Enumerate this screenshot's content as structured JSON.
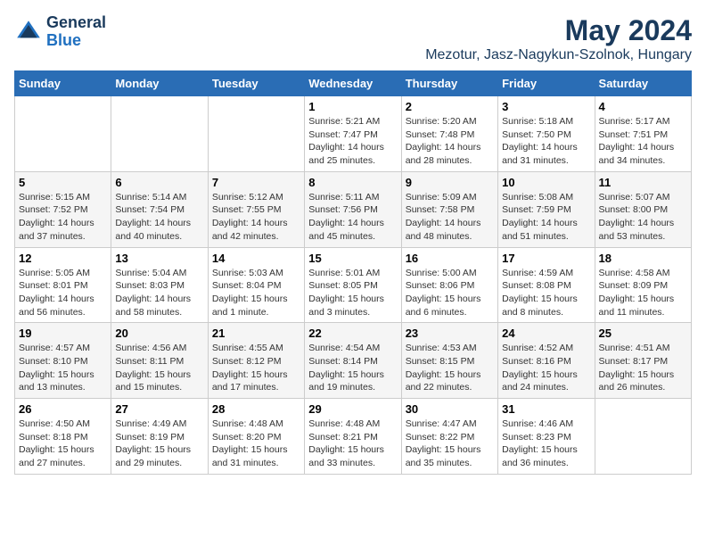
{
  "header": {
    "logo_general": "General",
    "logo_blue": "Blue",
    "main_title": "May 2024",
    "subtitle": "Mezotur, Jasz-Nagykun-Szolnok, Hungary"
  },
  "columns": [
    "Sunday",
    "Monday",
    "Tuesday",
    "Wednesday",
    "Thursday",
    "Friday",
    "Saturday"
  ],
  "weeks": [
    {
      "days": [
        {
          "num": "",
          "detail": ""
        },
        {
          "num": "",
          "detail": ""
        },
        {
          "num": "",
          "detail": ""
        },
        {
          "num": "1",
          "detail": "Sunrise: 5:21 AM\nSunset: 7:47 PM\nDaylight: 14 hours\nand 25 minutes."
        },
        {
          "num": "2",
          "detail": "Sunrise: 5:20 AM\nSunset: 7:48 PM\nDaylight: 14 hours\nand 28 minutes."
        },
        {
          "num": "3",
          "detail": "Sunrise: 5:18 AM\nSunset: 7:50 PM\nDaylight: 14 hours\nand 31 minutes."
        },
        {
          "num": "4",
          "detail": "Sunrise: 5:17 AM\nSunset: 7:51 PM\nDaylight: 14 hours\nand 34 minutes."
        }
      ]
    },
    {
      "days": [
        {
          "num": "5",
          "detail": "Sunrise: 5:15 AM\nSunset: 7:52 PM\nDaylight: 14 hours\nand 37 minutes."
        },
        {
          "num": "6",
          "detail": "Sunrise: 5:14 AM\nSunset: 7:54 PM\nDaylight: 14 hours\nand 40 minutes."
        },
        {
          "num": "7",
          "detail": "Sunrise: 5:12 AM\nSunset: 7:55 PM\nDaylight: 14 hours\nand 42 minutes."
        },
        {
          "num": "8",
          "detail": "Sunrise: 5:11 AM\nSunset: 7:56 PM\nDaylight: 14 hours\nand 45 minutes."
        },
        {
          "num": "9",
          "detail": "Sunrise: 5:09 AM\nSunset: 7:58 PM\nDaylight: 14 hours\nand 48 minutes."
        },
        {
          "num": "10",
          "detail": "Sunrise: 5:08 AM\nSunset: 7:59 PM\nDaylight: 14 hours\nand 51 minutes."
        },
        {
          "num": "11",
          "detail": "Sunrise: 5:07 AM\nSunset: 8:00 PM\nDaylight: 14 hours\nand 53 minutes."
        }
      ]
    },
    {
      "days": [
        {
          "num": "12",
          "detail": "Sunrise: 5:05 AM\nSunset: 8:01 PM\nDaylight: 14 hours\nand 56 minutes."
        },
        {
          "num": "13",
          "detail": "Sunrise: 5:04 AM\nSunset: 8:03 PM\nDaylight: 14 hours\nand 58 minutes."
        },
        {
          "num": "14",
          "detail": "Sunrise: 5:03 AM\nSunset: 8:04 PM\nDaylight: 15 hours\nand 1 minute."
        },
        {
          "num": "15",
          "detail": "Sunrise: 5:01 AM\nSunset: 8:05 PM\nDaylight: 15 hours\nand 3 minutes."
        },
        {
          "num": "16",
          "detail": "Sunrise: 5:00 AM\nSunset: 8:06 PM\nDaylight: 15 hours\nand 6 minutes."
        },
        {
          "num": "17",
          "detail": "Sunrise: 4:59 AM\nSunset: 8:08 PM\nDaylight: 15 hours\nand 8 minutes."
        },
        {
          "num": "18",
          "detail": "Sunrise: 4:58 AM\nSunset: 8:09 PM\nDaylight: 15 hours\nand 11 minutes."
        }
      ]
    },
    {
      "days": [
        {
          "num": "19",
          "detail": "Sunrise: 4:57 AM\nSunset: 8:10 PM\nDaylight: 15 hours\nand 13 minutes."
        },
        {
          "num": "20",
          "detail": "Sunrise: 4:56 AM\nSunset: 8:11 PM\nDaylight: 15 hours\nand 15 minutes."
        },
        {
          "num": "21",
          "detail": "Sunrise: 4:55 AM\nSunset: 8:12 PM\nDaylight: 15 hours\nand 17 minutes."
        },
        {
          "num": "22",
          "detail": "Sunrise: 4:54 AM\nSunset: 8:14 PM\nDaylight: 15 hours\nand 19 minutes."
        },
        {
          "num": "23",
          "detail": "Sunrise: 4:53 AM\nSunset: 8:15 PM\nDaylight: 15 hours\nand 22 minutes."
        },
        {
          "num": "24",
          "detail": "Sunrise: 4:52 AM\nSunset: 8:16 PM\nDaylight: 15 hours\nand 24 minutes."
        },
        {
          "num": "25",
          "detail": "Sunrise: 4:51 AM\nSunset: 8:17 PM\nDaylight: 15 hours\nand 26 minutes."
        }
      ]
    },
    {
      "days": [
        {
          "num": "26",
          "detail": "Sunrise: 4:50 AM\nSunset: 8:18 PM\nDaylight: 15 hours\nand 27 minutes."
        },
        {
          "num": "27",
          "detail": "Sunrise: 4:49 AM\nSunset: 8:19 PM\nDaylight: 15 hours\nand 29 minutes."
        },
        {
          "num": "28",
          "detail": "Sunrise: 4:48 AM\nSunset: 8:20 PM\nDaylight: 15 hours\nand 31 minutes."
        },
        {
          "num": "29",
          "detail": "Sunrise: 4:48 AM\nSunset: 8:21 PM\nDaylight: 15 hours\nand 33 minutes."
        },
        {
          "num": "30",
          "detail": "Sunrise: 4:47 AM\nSunset: 8:22 PM\nDaylight: 15 hours\nand 35 minutes."
        },
        {
          "num": "31",
          "detail": "Sunrise: 4:46 AM\nSunset: 8:23 PM\nDaylight: 15 hours\nand 36 minutes."
        },
        {
          "num": "",
          "detail": ""
        }
      ]
    }
  ]
}
